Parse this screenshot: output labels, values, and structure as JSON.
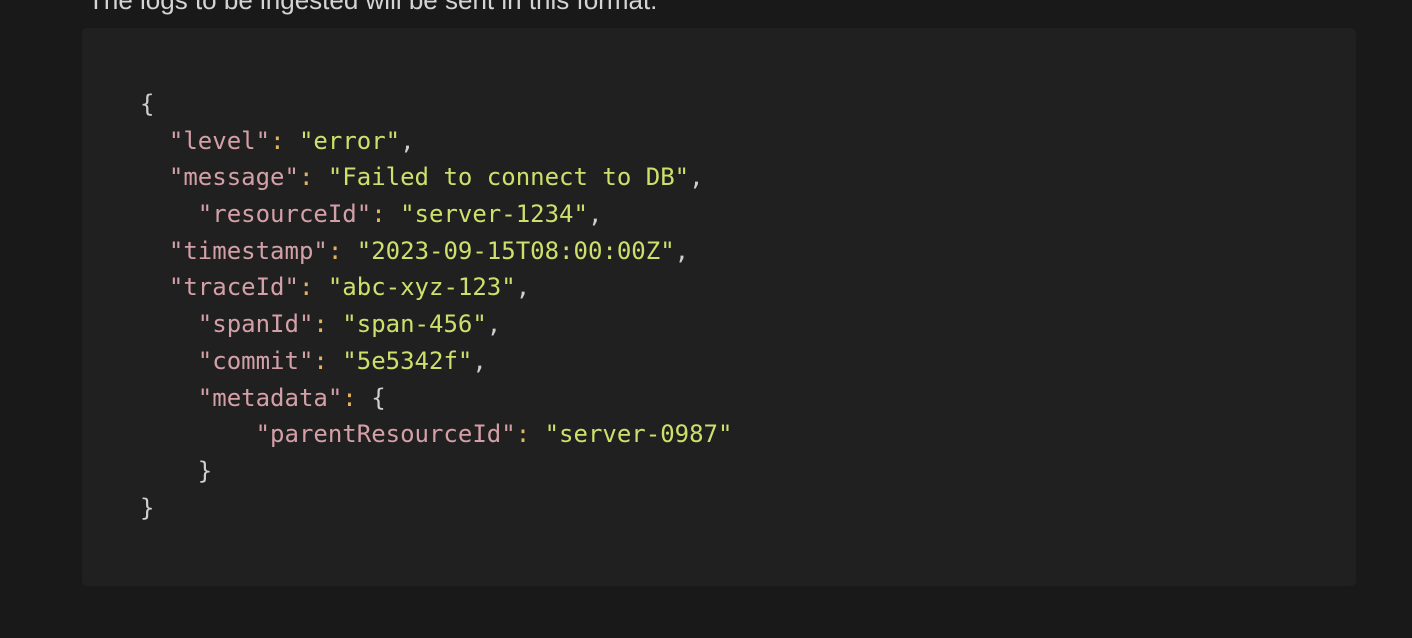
{
  "intro_text": "The logs to be ingested will be sent in this format:",
  "code": {
    "open_brace": "{",
    "close_brace": "}",
    "level": {
      "key": "\"level\"",
      "value": "\"error\""
    },
    "message": {
      "key": "\"message\"",
      "value": "\"Failed to connect to DB\""
    },
    "resourceId": {
      "key": "\"resourceId\"",
      "value": "\"server-1234\""
    },
    "timestamp": {
      "key": "\"timestamp\"",
      "value": "\"2023-09-15T08:00:00Z\""
    },
    "traceId": {
      "key": "\"traceId\"",
      "value": "\"abc-xyz-123\""
    },
    "spanId": {
      "key": "\"spanId\"",
      "value": "\"span-456\""
    },
    "commit": {
      "key": "\"commit\"",
      "value": "\"5e5342f\""
    },
    "metadata": {
      "key": "\"metadata\"",
      "open_brace": "{",
      "close_brace": "}",
      "parentResourceId": {
        "key": "\"parentResourceId\"",
        "value": "\"server-0987\""
      }
    }
  }
}
